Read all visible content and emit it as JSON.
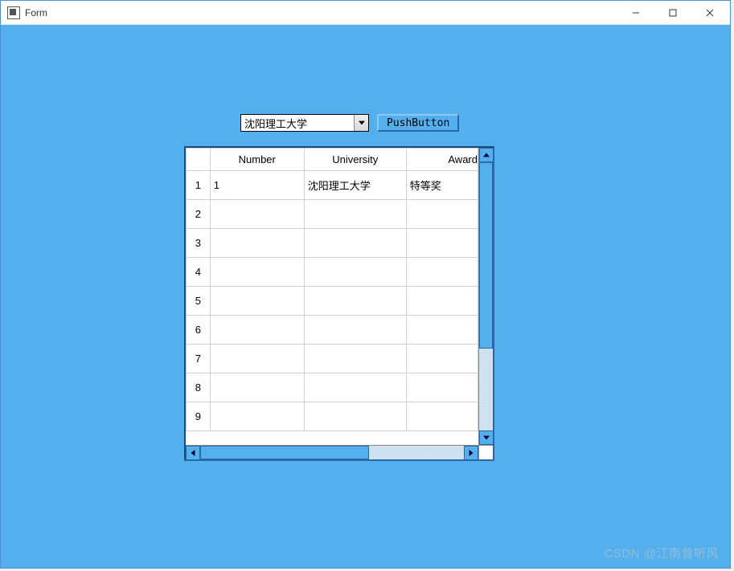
{
  "window": {
    "title": "Form"
  },
  "controls": {
    "combobox_value": "沈阳理工大学",
    "pushbutton_label": "PushButton"
  },
  "table": {
    "headers": {
      "col1": "Number",
      "col2": "University",
      "col3": "Award"
    },
    "row_count": 9,
    "rows": [
      {
        "idx": "1",
        "number": "1",
        "university": "沈阳理工大学",
        "award": "特等奖"
      },
      {
        "idx": "2",
        "number": "",
        "university": "",
        "award": ""
      },
      {
        "idx": "3",
        "number": "",
        "university": "",
        "award": ""
      },
      {
        "idx": "4",
        "number": "",
        "university": "",
        "award": ""
      },
      {
        "idx": "5",
        "number": "",
        "university": "",
        "award": ""
      },
      {
        "idx": "6",
        "number": "",
        "university": "",
        "award": ""
      },
      {
        "idx": "7",
        "number": "",
        "university": "",
        "award": ""
      },
      {
        "idx": "8",
        "number": "",
        "university": "",
        "award": ""
      },
      {
        "idx": "9",
        "number": "",
        "university": "",
        "award": ""
      }
    ]
  },
  "watermark": "CSDN @江南曾听风"
}
